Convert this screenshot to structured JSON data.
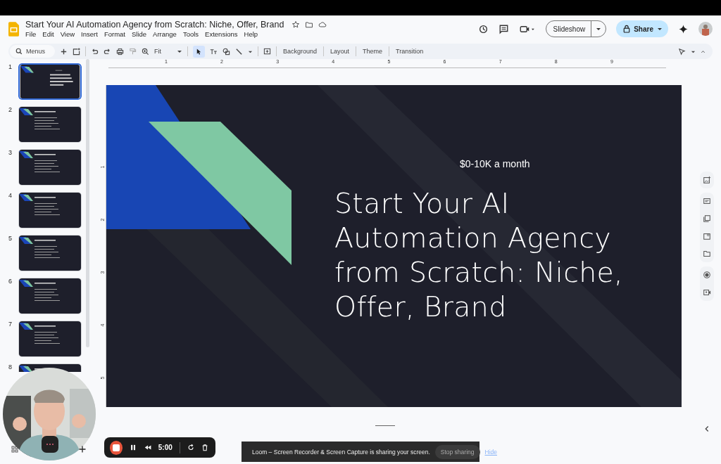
{
  "document": {
    "title": "Start Your AI Automation Agency from Scratch: Niche, Offer, Brand"
  },
  "menu": [
    "File",
    "Edit",
    "View",
    "Insert",
    "Format",
    "Slide",
    "Arrange",
    "Tools",
    "Extensions",
    "Help"
  ],
  "header_buttons": {
    "slideshow": "Slideshow",
    "share": "Share"
  },
  "toolbar": {
    "search": "Menus",
    "zoom": "Fit",
    "buttons": [
      "Background",
      "Layout",
      "Theme",
      "Transition"
    ]
  },
  "ruler": [
    "1",
    "2",
    "3",
    "4",
    "5",
    "6",
    "7",
    "8",
    "9"
  ],
  "vertical_ruler": [
    "1",
    "2",
    "3",
    "4",
    "5"
  ],
  "slides": [
    {
      "number": "1",
      "selected": true
    },
    {
      "number": "2",
      "selected": false
    },
    {
      "number": "3",
      "selected": false
    },
    {
      "number": "4",
      "selected": false
    },
    {
      "number": "5",
      "selected": false
    },
    {
      "number": "6",
      "selected": false
    },
    {
      "number": "7",
      "selected": false
    },
    {
      "number": "8",
      "selected": false
    }
  ],
  "slide": {
    "subtitle": "$0-10K a month",
    "title": "Start Your AI Automation Agency from Scratch: Niche, Offer, Brand"
  },
  "recorder": {
    "timer": "5:00"
  },
  "share_banner": {
    "message": "Loom – Screen Recorder & Screen Capture is sharing your screen.",
    "stop": "Stop sharing",
    "hide": "Hide"
  }
}
